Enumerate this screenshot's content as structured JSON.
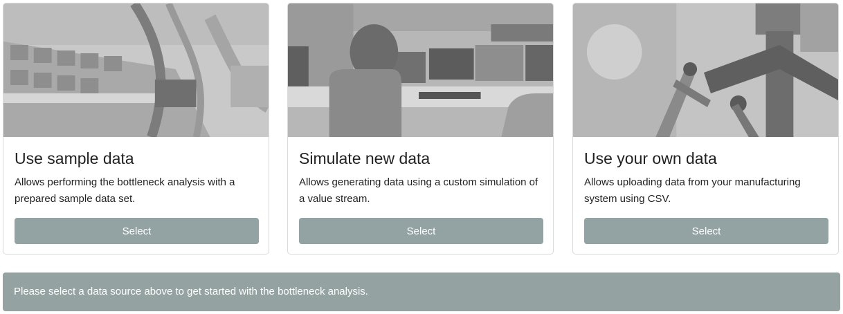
{
  "cards": [
    {
      "image_icon": "network-switch-photo",
      "title": "Use sample data",
      "description": "Allows performing the bottleneck analysis with a prepared sample data set.",
      "button_label": "Select"
    },
    {
      "image_icon": "control-room-photo",
      "title": "Simulate new data",
      "description": "Allows generating data using a custom simulation of a value stream.",
      "button_label": "Select"
    },
    {
      "image_icon": "machinery-photo",
      "title": "Use your own data",
      "description": "Allows uploading data from your manufacturing system using CSV.",
      "button_label": "Select"
    }
  ],
  "alert": {
    "message": "Please select a data source above to get started with the bottleneck analysis."
  },
  "colors": {
    "button_bg": "#93a3a3",
    "alert_bg": "#94a3a1",
    "card_border": "#d8dadc",
    "text": "#222222"
  }
}
